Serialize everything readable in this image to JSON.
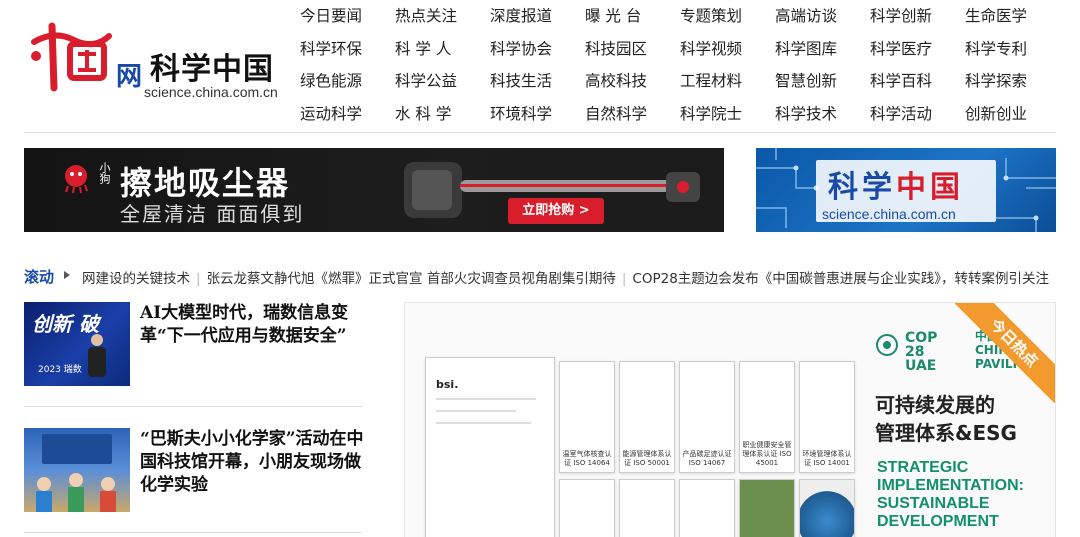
{
  "header": {
    "logo_wang": "网",
    "logo_title": "科学中国",
    "logo_domain": "science.china.com.cn"
  },
  "nav": [
    "今日要闻",
    "热点关注",
    "深度报道",
    "曝 光 台",
    "专题策划",
    "高端访谈",
    "科学创新",
    "生命医学",
    "科学环保",
    "科 学 人",
    "科学协会",
    "科技园区",
    "科学视频",
    "科学图库",
    "科学医疗",
    "科学专利",
    "绿色能源",
    "科学公益",
    "科技生活",
    "高校科技",
    "工程材料",
    "智慧创新",
    "科学百科",
    "科学探索",
    "运动科学",
    "水 科 学",
    "环境科学",
    "自然科学",
    "科学院士",
    "科学技术",
    "科学活动",
    "创新创业"
  ],
  "ad": {
    "brand": "小狗",
    "headline": "擦地吸尘器",
    "sub": "全屋清洁 面面俱到",
    "button": "立即抢购 >"
  },
  "logo_banner": {
    "title_part1": "科学",
    "title_part2": "中国",
    "domain": "science.china.com.cn"
  },
  "ticker": {
    "label": "滚动",
    "items": [
      "网建设的关键技术",
      "张云龙蔡文静代旭《燃罪》正式官宣 首部火灾调查员视角剧集引期待",
      "COP28主题边会发布《中国碳普惠进展与企业实践》，转转案例引关注"
    ]
  },
  "news": [
    {
      "title": "AI大模型时代，瑞数信息变革“下一代应用与数据安全”",
      "thumb_text": "创新 破",
      "thumb_sub": "2023 瑞数"
    },
    {
      "title": "“巴斯夫小小化学家”活动在中国科技馆开幕，小朋友现场做化学实验",
      "thumb_text": "",
      "thumb_sub": ""
    }
  ],
  "feature": {
    "hot": "今日热点",
    "cop": "COP 28 UAE",
    "china": "中国 CHINA PAVILION",
    "title_cn_line1": "可持续发展的",
    "title_cn_line2": "管理体系&ESG",
    "title_en": [
      "STRATEGIC",
      "IMPLEMENTATION:",
      "SUSTAINABLE",
      "DEVELOPMENT"
    ],
    "certs": [
      "温室气体核查认证 ISO 14064",
      "能源管理体系认证 ISO 50001",
      "产品碳足迹认证 ISO 14067",
      "职业健康安全管理体系认证 ISO 45001",
      "环境管理体系认证 ISO 14001"
    ]
  }
}
